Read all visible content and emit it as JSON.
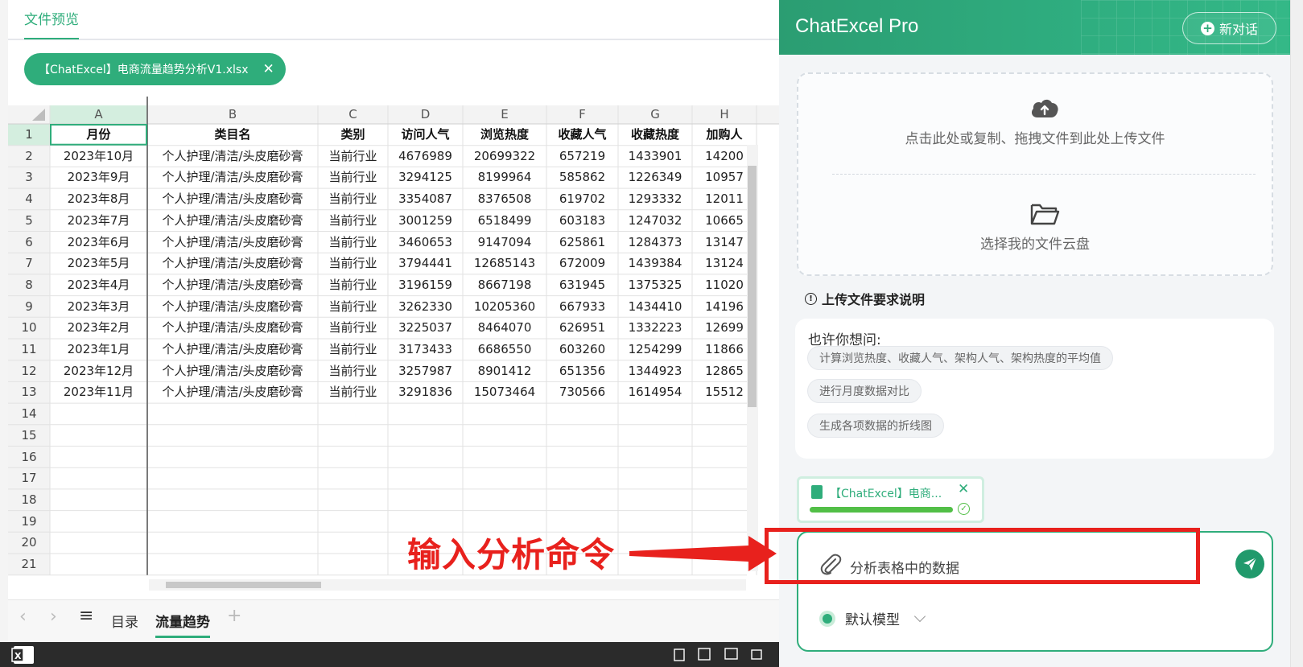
{
  "preview": {
    "tab_label": "文件预览",
    "file_chip_label": "【ChatExcel】电商流量趋势分析V1.xlsx",
    "close_glyph": "✕"
  },
  "sheet": {
    "columns": [
      "A",
      "B",
      "C",
      "D",
      "E",
      "F",
      "G",
      "H"
    ],
    "header_row": [
      "月份",
      "类目名",
      "类别",
      "访问人气",
      "浏览热度",
      "收藏人气",
      "收藏热度",
      "加购人"
    ],
    "rows": [
      [
        "2023年10月",
        "个人护理/清洁/头皮磨砂膏",
        "当前行业",
        "4676989",
        "20699322",
        "657219",
        "1433901",
        "14200"
      ],
      [
        "2023年9月",
        "个人护理/清洁/头皮磨砂膏",
        "当前行业",
        "3294125",
        "8199964",
        "585862",
        "1226349",
        "10957"
      ],
      [
        "2023年8月",
        "个人护理/清洁/头皮磨砂膏",
        "当前行业",
        "3354087",
        "8376508",
        "619702",
        "1293332",
        "12011"
      ],
      [
        "2023年7月",
        "个人护理/清洁/头皮磨砂膏",
        "当前行业",
        "3001259",
        "6518499",
        "603183",
        "1247032",
        "10665"
      ],
      [
        "2023年6月",
        "个人护理/清洁/头皮磨砂膏",
        "当前行业",
        "3460653",
        "9147094",
        "625861",
        "1284373",
        "13147"
      ],
      [
        "2023年5月",
        "个人护理/清洁/头皮磨砂膏",
        "当前行业",
        "3794441",
        "12685143",
        "672009",
        "1439384",
        "13124"
      ],
      [
        "2023年4月",
        "个人护理/清洁/头皮磨砂膏",
        "当前行业",
        "3196159",
        "8667198",
        "631945",
        "1375325",
        "11020"
      ],
      [
        "2023年3月",
        "个人护理/清洁/头皮磨砂膏",
        "当前行业",
        "3262330",
        "10205360",
        "667933",
        "1434410",
        "14196"
      ],
      [
        "2023年2月",
        "个人护理/清洁/头皮磨砂膏",
        "当前行业",
        "3225037",
        "8464070",
        "626951",
        "1332223",
        "12699"
      ],
      [
        "2023年1月",
        "个人护理/清洁/头皮磨砂膏",
        "当前行业",
        "3173433",
        "6686550",
        "603260",
        "1254299",
        "11866"
      ],
      [
        "2023年12月",
        "个人护理/清洁/头皮磨砂膏",
        "当前行业",
        "3257987",
        "8901412",
        "651356",
        "1344923",
        "12865"
      ],
      [
        "2023年11月",
        "个人护理/清洁/头皮磨砂膏",
        "当前行业",
        "3291836",
        "15073464",
        "730566",
        "1614954",
        "15512"
      ]
    ],
    "row_numbers": [
      "1",
      "2",
      "3",
      "4",
      "5",
      "6",
      "7",
      "8",
      "9",
      "10",
      "11",
      "12",
      "13",
      "14",
      "15",
      "16",
      "17",
      "18",
      "19",
      "20",
      "21"
    ],
    "sheet_tabs": {
      "tab1": "目录",
      "tab2": "流量趋势",
      "add": "+"
    },
    "nav": {
      "prev": "‹",
      "next": "›",
      "menu": "≡"
    }
  },
  "annotation": {
    "text": "输入分析命令",
    "color": "#e8211d"
  },
  "panel": {
    "title": "ChatExcel Pro",
    "new_chat_label": "新对话",
    "upload_text": "点击此处或复制、拖拽文件到此处上传文件",
    "cloud_text": "选择我的文件云盘",
    "requirements_label": "上传文件要求说明",
    "suggest_title": "也许你想问:",
    "suggestions": [
      "计算浏览热度、收藏人气、架构人气、架构热度的平均值",
      "进行月度数据对比",
      "生成各项数据的折线图"
    ],
    "attachment": {
      "name": "【ChatExcel】电商...",
      "progress": 1.0
    },
    "input_value": "分析表格中的数据",
    "model_label": "默认模型"
  },
  "colors": {
    "accent": "#2fad7b",
    "header": "#2b9d72",
    "annotation": "#e8211d"
  }
}
